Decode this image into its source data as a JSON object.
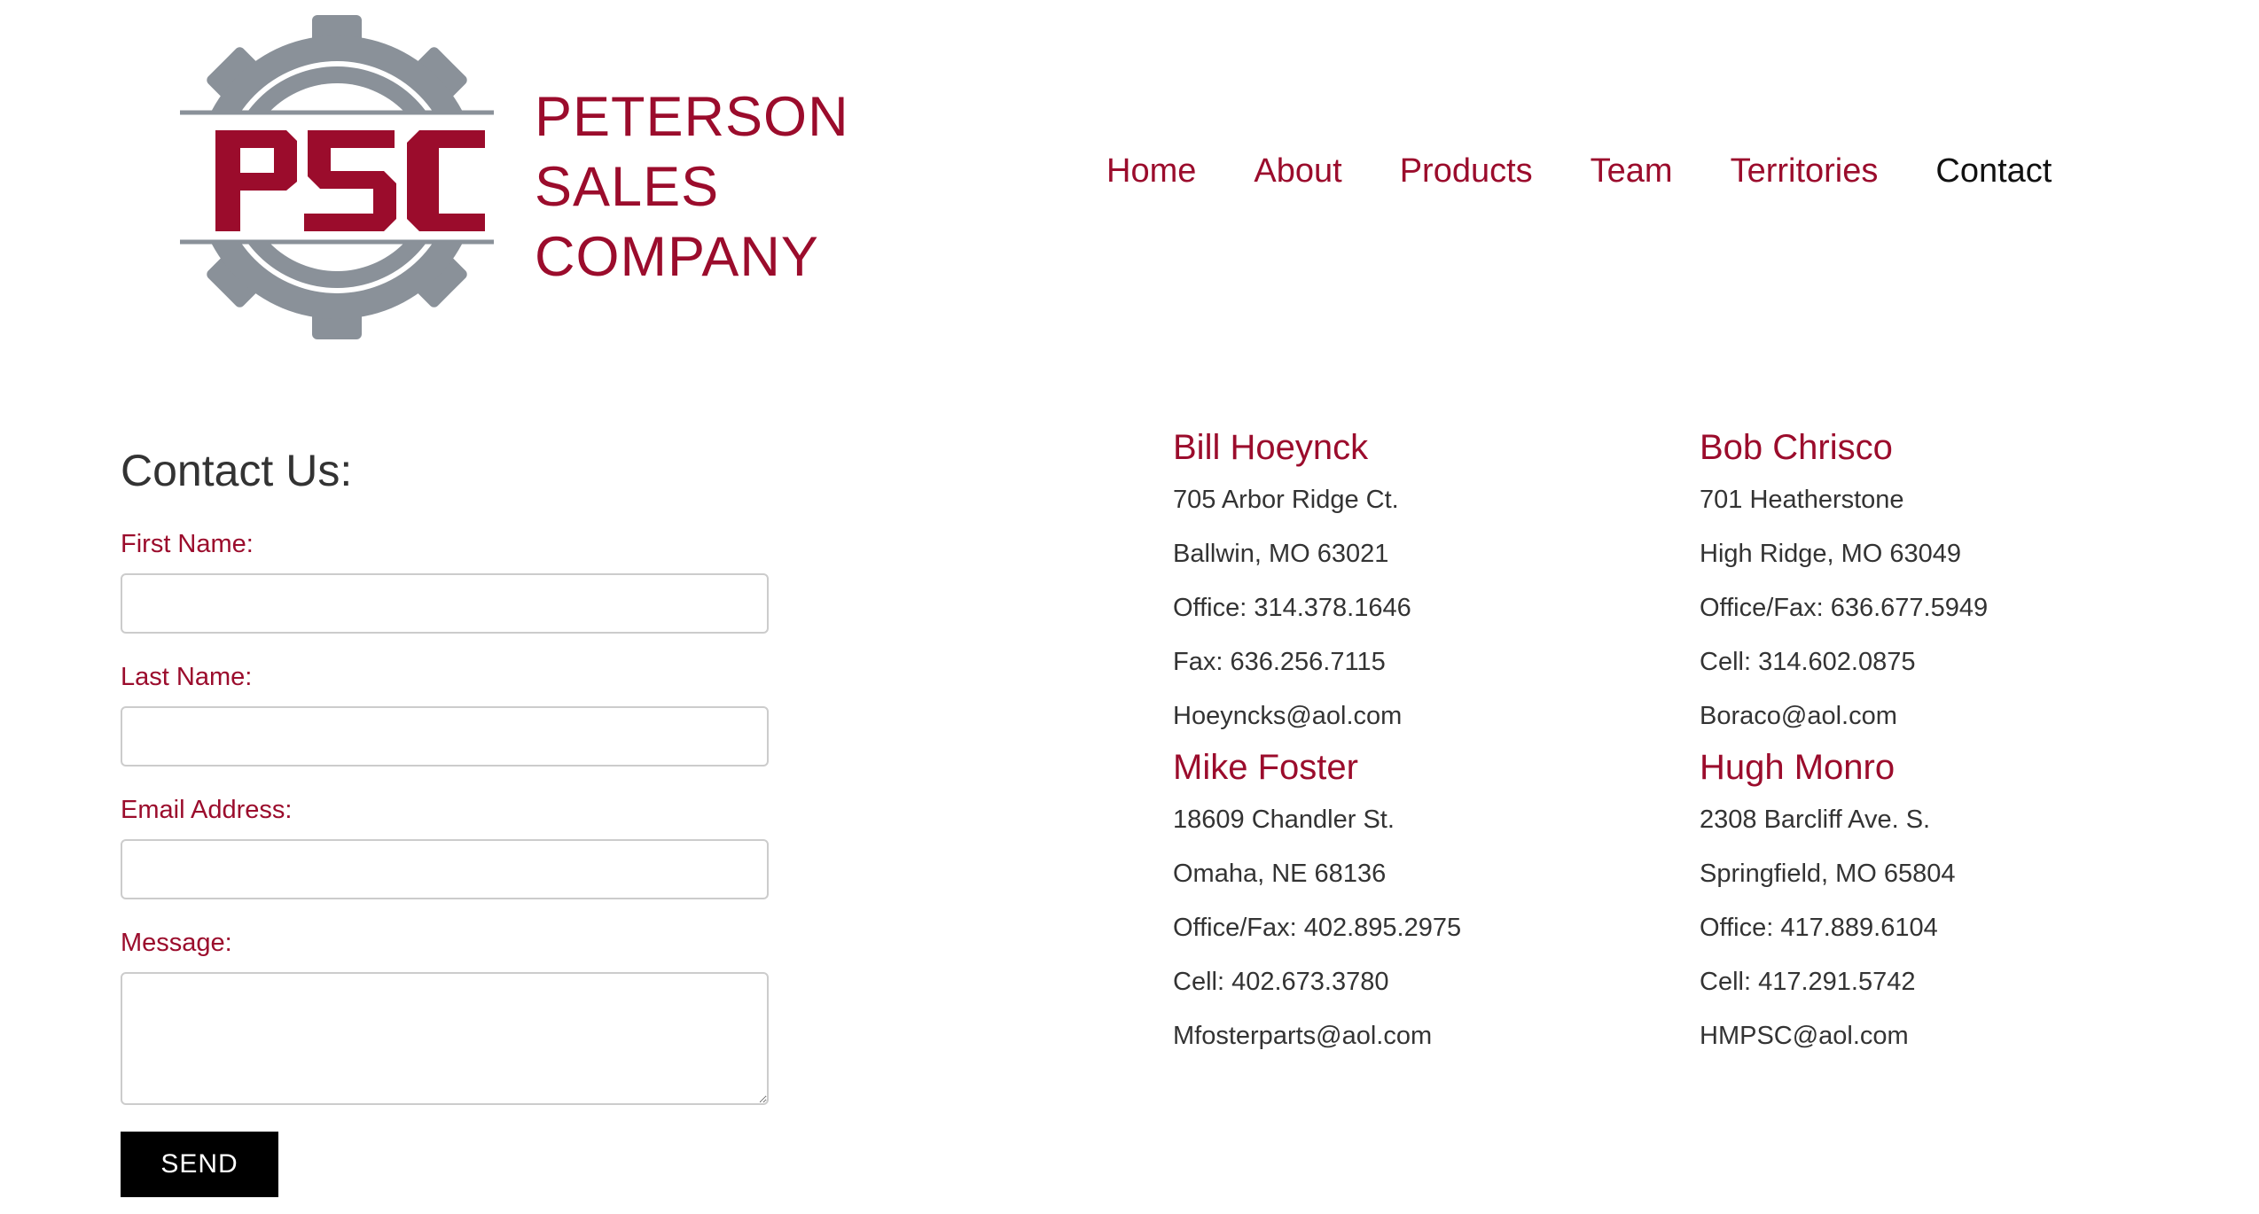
{
  "brand": {
    "logo_mark": "PSC",
    "name_lines": [
      "PETERSON",
      "SALES",
      "COMPANY"
    ],
    "colors": {
      "primary": "#9b0c2c",
      "gear": "#8a9199"
    }
  },
  "nav": {
    "items": [
      {
        "label": "Home"
      },
      {
        "label": "About"
      },
      {
        "label": "Products"
      },
      {
        "label": "Team"
      },
      {
        "label": "Territories"
      },
      {
        "label": "Contact",
        "active": true
      }
    ]
  },
  "form": {
    "title": "Contact Us:",
    "fields": [
      {
        "label": "First Name:",
        "value": ""
      },
      {
        "label": "Last Name:",
        "value": ""
      },
      {
        "label": "Email Address:",
        "value": ""
      },
      {
        "label": "Message:",
        "value": ""
      }
    ],
    "submit_label": "SEND"
  },
  "contacts": [
    {
      "name": "Bill Hoeynck",
      "lines": [
        "705 Arbor Ridge Ct.",
        "Ballwin, MO 63021",
        "Office: 314.378.1646",
        "Fax: 636.256.7115",
        "Hoeyncks@aol.com"
      ]
    },
    {
      "name": "Bob Chrisco",
      "lines": [
        "701 Heatherstone",
        "High Ridge, MO 63049",
        "Office/Fax: 636.677.5949",
        "Cell: 314.602.0875",
        "Boraco@aol.com"
      ]
    },
    {
      "name": "Mike Foster",
      "lines": [
        "18609 Chandler St.",
        "Omaha, NE 68136",
        "Office/Fax: 402.895.2975",
        "Cell: 402.673.3780",
        "Mfosterparts@aol.com"
      ]
    },
    {
      "name": "Hugh Monro",
      "lines": [
        "2308 Barcliff Ave. S.",
        "Springfield, MO 65804",
        "Office: 417.889.6104",
        "Cell: 417.291.5742",
        "HMPSC@aol.com"
      ]
    }
  ]
}
